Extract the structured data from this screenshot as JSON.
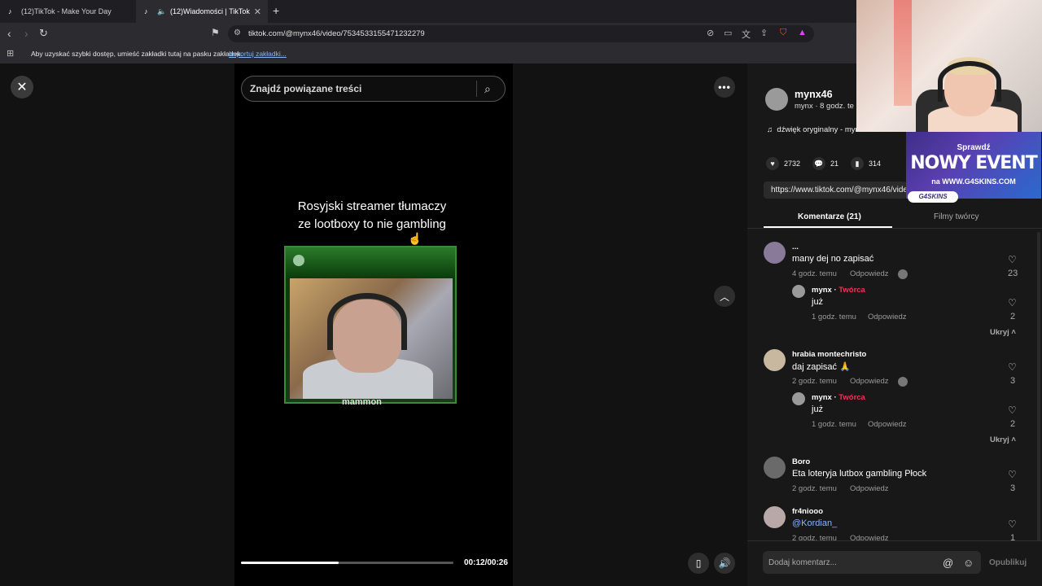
{
  "browser": {
    "tabs": [
      {
        "label": "(12)TikTok - Make Your Day"
      },
      {
        "label": "(12)Wiadomości | TikTok"
      }
    ],
    "url": "tiktok.com/@mynx46/video/7534533155471232279",
    "bookmarks_text": "Aby uzyskać szybki dostęp, umieść zakładki tutaj na pasku zakładek.",
    "bookmarks_link": "Importuj zakładki..."
  },
  "video": {
    "search_placeholder": "Znajdź powiązane treści",
    "caption_line1": "Rosyjski streamer tłumaczy",
    "caption_line2": "ze lootboxy to nie gambling",
    "clip_label": "mammon",
    "time": "00:12/00:26",
    "progress": 0.46
  },
  "author": {
    "name": "mynx46",
    "subtitle": "mynx · 8 godz. te",
    "music": "dźwięk oryginalny - mynx",
    "likes": "2732",
    "comments": "21",
    "saves": "314",
    "link": "https://www.tiktok.com/@mynx46/video/7534533155471232279"
  },
  "tabs": {
    "comments": "Komentarze (21)",
    "creator": "Filmy twórcy"
  },
  "comments": [
    {
      "name": "...",
      "text": "many dej no zapisać",
      "time": "4 godz. temu",
      "reply": "Odpowiedz",
      "likes": "23"
    },
    {
      "name": "mynx",
      "creator_tag": "Twórca",
      "text": "już",
      "time": "1 godz. temu",
      "reply": "Odpowiedz",
      "likes": "2"
    },
    {
      "name": "hrabia montechristo",
      "text": "daj zapisać 🙏",
      "time": "2 godz. temu",
      "reply": "Odpowiedz",
      "likes": "3"
    },
    {
      "name": "mynx",
      "creator_tag": "Twórca",
      "text": "już",
      "time": "1 godz. temu",
      "reply": "Odpowiedz",
      "likes": "2"
    },
    {
      "name": "Boro",
      "text": "Eta loteryja lutbox gambling Płock",
      "time": "2 godz. temu",
      "reply": "Odpowiedz",
      "likes": "3"
    },
    {
      "name": "fr4niooo",
      "text": "@Kordian_",
      "time": "2 godz. temu",
      "reply": "Odpowiedz",
      "likes": "1"
    }
  ],
  "hide_label": "Ukryj",
  "comment_bar": {
    "placeholder": "Dodaj komentarz...",
    "publish": "Opublikuj"
  },
  "ad": {
    "line1": "Sprawdź",
    "line2": "NOWY EVENT",
    "line3": "na WWW.G4SKINS.COM",
    "logo": "G4SKINS"
  }
}
